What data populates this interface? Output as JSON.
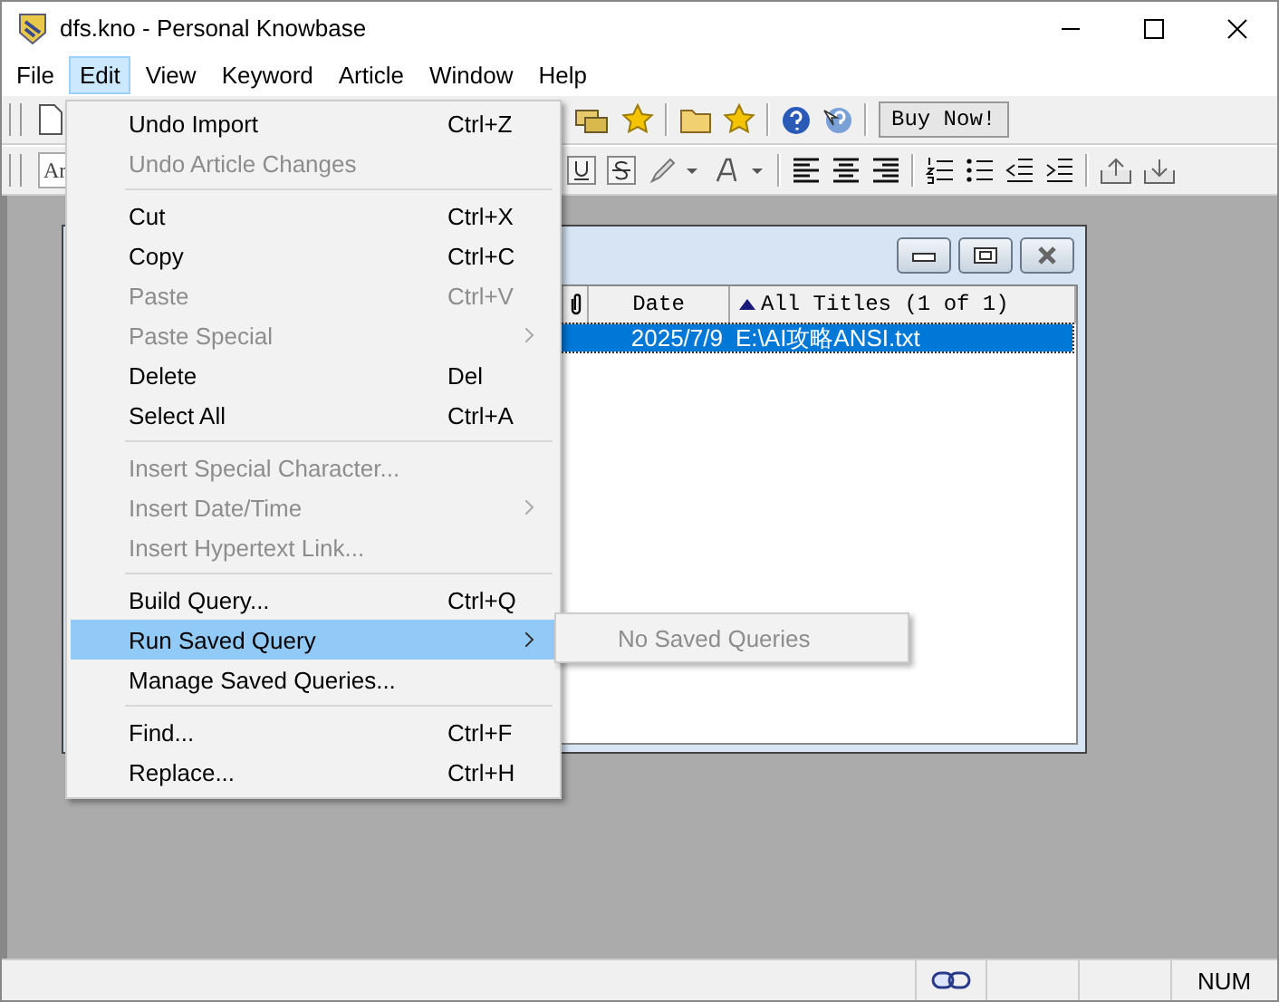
{
  "window": {
    "title": "dfs.kno - Personal Knowbase"
  },
  "menu_bar": [
    {
      "label": "File",
      "selected": false
    },
    {
      "label": "Edit",
      "selected": true
    },
    {
      "label": "View",
      "selected": false
    },
    {
      "label": "Keyword",
      "selected": false
    },
    {
      "label": "Article",
      "selected": false
    },
    {
      "label": "Window",
      "selected": false
    },
    {
      "label": "Help",
      "selected": false
    }
  ],
  "toolbar": {
    "font_field": "Ar",
    "buy_button": "Buy Now!"
  },
  "child_window": {
    "columns": [
      {
        "label": "Date",
        "sorted": false
      },
      {
        "label": "All Titles (1 of 1)",
        "sorted": true
      }
    ],
    "rows": [
      {
        "date": "2025/7/9",
        "title": "E:\\AI攻略ANSI.txt",
        "selected": true
      }
    ]
  },
  "edit_menu": [
    {
      "kind": "item",
      "label": "Undo Import",
      "shortcut": "Ctrl+Z",
      "disabled": false,
      "submenu": false,
      "selected": false
    },
    {
      "kind": "item",
      "label": "Undo Article Changes",
      "disabled": true,
      "submenu": false,
      "selected": false
    },
    {
      "kind": "separator"
    },
    {
      "kind": "item",
      "label": "Cut",
      "shortcut": "Ctrl+X",
      "disabled": false,
      "submenu": false,
      "selected": false
    },
    {
      "kind": "item",
      "label": "Copy",
      "shortcut": "Ctrl+C",
      "disabled": false,
      "submenu": false,
      "selected": false
    },
    {
      "kind": "item",
      "label": "Paste",
      "shortcut": "Ctrl+V",
      "disabled": true,
      "submenu": false,
      "selected": false
    },
    {
      "kind": "item",
      "label": "Paste Special",
      "disabled": true,
      "submenu": true,
      "selected": false
    },
    {
      "kind": "item",
      "label": "Delete",
      "shortcut": "Del",
      "disabled": false,
      "submenu": false,
      "selected": false
    },
    {
      "kind": "item",
      "label": "Select All",
      "shortcut": "Ctrl+A",
      "disabled": false,
      "submenu": false,
      "selected": false
    },
    {
      "kind": "separator"
    },
    {
      "kind": "item",
      "label": "Insert Special Character...",
      "disabled": true,
      "submenu": false,
      "selected": false
    },
    {
      "kind": "item",
      "label": "Insert Date/Time",
      "disabled": true,
      "submenu": true,
      "selected": false
    },
    {
      "kind": "item",
      "label": "Insert Hypertext Link...",
      "disabled": true,
      "submenu": false,
      "selected": false
    },
    {
      "kind": "separator"
    },
    {
      "kind": "item",
      "label": "Build Query...",
      "shortcut": "Ctrl+Q",
      "disabled": false,
      "submenu": false,
      "selected": false
    },
    {
      "kind": "item",
      "label": "Run Saved Query",
      "disabled": false,
      "submenu": true,
      "selected": true
    },
    {
      "kind": "item",
      "label": "Manage Saved Queries...",
      "disabled": false,
      "submenu": false,
      "selected": false
    },
    {
      "kind": "separator"
    },
    {
      "kind": "item",
      "label": "Find...",
      "shortcut": "Ctrl+F",
      "disabled": false,
      "submenu": false,
      "selected": false
    },
    {
      "kind": "item",
      "label": "Replace...",
      "shortcut": "Ctrl+H",
      "disabled": false,
      "submenu": false,
      "selected": false
    }
  ],
  "submenu": {
    "items": [
      {
        "label": "No Saved Queries",
        "disabled": true
      }
    ]
  },
  "status_bar": {
    "indicator": "NUM"
  }
}
